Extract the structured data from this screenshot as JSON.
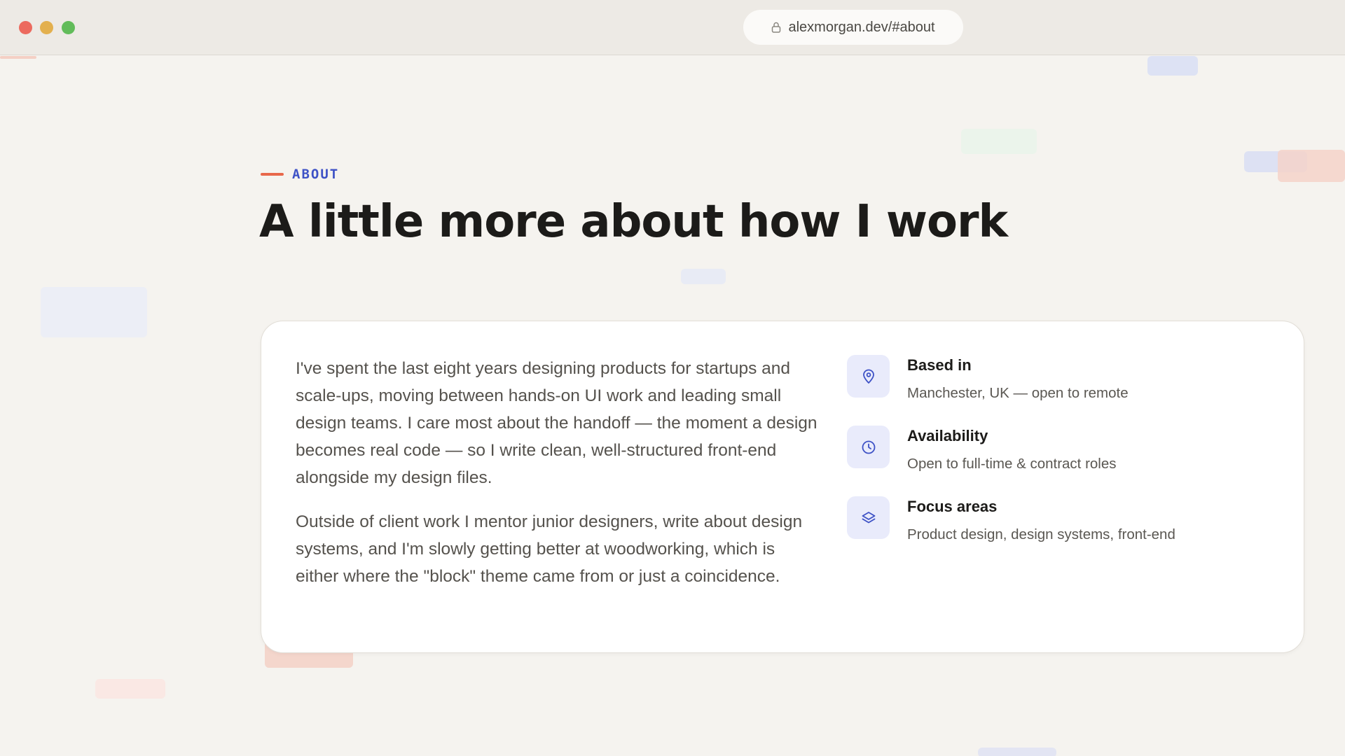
{
  "browser": {
    "url": "alexmorgan.dev/#about"
  },
  "about": {
    "eyebrow": "ABOUT",
    "title": "A little more about how I work",
    "paragraphs": [
      "I've spent the last eight years designing products for startups and scale-ups, moving between hands-on UI work and leading small design teams. I care most about the handoff — the moment a design becomes real code — so I write clean, well-structured front-end alongside my design files.",
      "Outside of client work I mentor junior designers, write about design systems, and I'm slowly getting better at woodworking, which is either where the \"block\" theme came from or just a coincidence."
    ],
    "facts": [
      {
        "label": "Based in",
        "value": "Manchester, UK — open to remote",
        "icon": "map-pin-icon"
      },
      {
        "label": "Availability",
        "value": "Open to full-time & contract roles",
        "icon": "clock-icon"
      },
      {
        "label": "Focus areas",
        "value": "Product design, design systems, front-end",
        "icon": "layers-icon"
      }
    ]
  },
  "colors": {
    "accent": "#3e52c6",
    "eyebrow_line": "#e8684b",
    "background": "#f5f3ef"
  }
}
